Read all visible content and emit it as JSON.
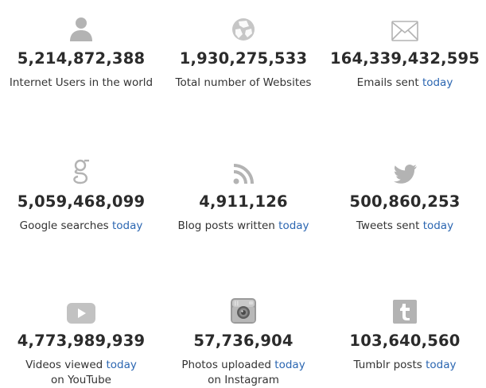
{
  "stats": [
    {
      "id": "internet-users",
      "icon": "user-icon",
      "value": "5,214,872,388",
      "caption": "Internet Users in the world",
      "highlight": "",
      "line2": ""
    },
    {
      "id": "websites",
      "icon": "globe-icon",
      "value": "1,930,275,533",
      "caption": "Total number of Websites",
      "highlight": "",
      "line2": ""
    },
    {
      "id": "emails",
      "icon": "envelope-icon",
      "value": "164,339,432,595",
      "caption": "Emails sent ",
      "highlight": "today",
      "line2": ""
    },
    {
      "id": "google",
      "icon": "google-icon",
      "value": "5,059,468,099",
      "caption": "Google searches ",
      "highlight": "today",
      "line2": ""
    },
    {
      "id": "blog",
      "icon": "rss-icon",
      "value": "4,911,126",
      "caption": "Blog posts written ",
      "highlight": "today",
      "line2": ""
    },
    {
      "id": "tweets",
      "icon": "twitter-bird-icon",
      "value": "500,860,253",
      "caption": "Tweets sent ",
      "highlight": "today",
      "line2": ""
    },
    {
      "id": "youtube",
      "icon": "youtube-play-icon",
      "value": "4,773,989,939",
      "caption": "Videos viewed ",
      "highlight": "today",
      "line2": "on YouTube"
    },
    {
      "id": "instagram",
      "icon": "instagram-camera-icon",
      "value": "57,736,904",
      "caption": "Photos uploaded ",
      "highlight": "today",
      "line2": "on Instagram"
    },
    {
      "id": "tumblr",
      "icon": "tumblr-icon",
      "value": "103,640,560",
      "caption": "Tumblr posts ",
      "highlight": "today",
      "line2": ""
    }
  ],
  "colors": {
    "icon": "#b3b3b3",
    "number": "#2b2b2b",
    "text": "#333333",
    "highlight": "#2b66b1"
  }
}
